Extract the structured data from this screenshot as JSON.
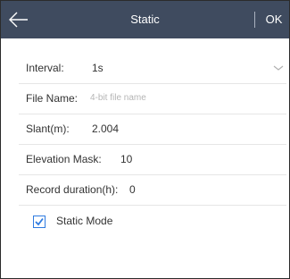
{
  "header": {
    "title": "Static",
    "ok_label": "OK"
  },
  "form": {
    "interval": {
      "label": "Interval:",
      "value": "1s"
    },
    "file_name": {
      "label": "File Name:",
      "placeholder": "4-bit file name"
    },
    "slant": {
      "label": "Slant(m):",
      "value": "2.004"
    },
    "elevation_mask": {
      "label": "Elevation Mask:",
      "value": "10"
    },
    "record_duration": {
      "label": "Record duration(h):",
      "value": "0"
    },
    "static_mode": {
      "label": "Static Mode",
      "checked": true
    }
  },
  "colors": {
    "header_bg": "#3f4b5f",
    "checkbox_accent": "#2f7be0"
  },
  "icons": {
    "back": "arrow-left-icon",
    "dropdown": "chevron-down-icon",
    "check": "checkmark-icon"
  }
}
